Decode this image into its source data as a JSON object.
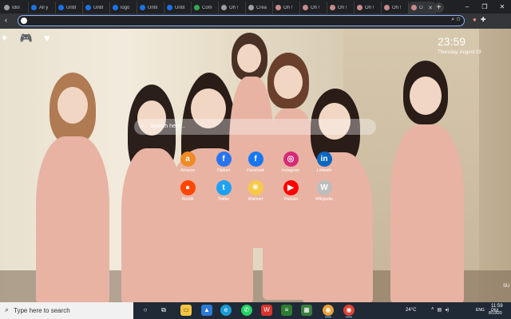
{
  "browser": {
    "tabs": [
      {
        "title": "Idol",
        "color": "#9aa0a6"
      },
      {
        "title": "All y",
        "color": "#1a73e8"
      },
      {
        "title": "Untit",
        "color": "#1a73e8"
      },
      {
        "title": "Untit",
        "color": "#1a73e8"
      },
      {
        "title": "logo",
        "color": "#1a73e8"
      },
      {
        "title": "Untit",
        "color": "#1a73e8"
      },
      {
        "title": "Untit",
        "color": "#1a73e8"
      },
      {
        "title": "Com",
        "color": "#34a853"
      },
      {
        "title": "Oh !",
        "color": "#9aa0a6"
      },
      {
        "title": "Crea",
        "color": "#9aa0a6"
      },
      {
        "title": "Oh !",
        "color": "#c98b8b"
      },
      {
        "title": "Oh !",
        "color": "#c98b8b"
      },
      {
        "title": "Oh !",
        "color": "#c98b8b"
      },
      {
        "title": "Oh !",
        "color": "#c98b8b"
      },
      {
        "title": "Oh !",
        "color": "#c98b8b"
      },
      {
        "title": "O",
        "color": "#c98b8b",
        "active": true
      }
    ],
    "omnibox_value": ""
  },
  "newtab": {
    "clock": "23:59",
    "date": "Thursday, August 19",
    "search_placeholder": "Search here...",
    "shortcuts": [
      {
        "label": "Amazon",
        "icon": "amazon-icon",
        "glyph": "a",
        "color": "#f08a24"
      },
      {
        "label": "Flipkart",
        "icon": "flipkart-icon",
        "glyph": "f",
        "color": "#2874f0"
      },
      {
        "label": "Facebook",
        "icon": "facebook-icon",
        "glyph": "f",
        "color": "#1877f2"
      },
      {
        "label": "Instagram",
        "icon": "instagram-icon",
        "glyph": "◎",
        "color": "#d62976"
      },
      {
        "label": "Linkedin",
        "icon": "linkedin-icon",
        "glyph": "in",
        "color": "#0a66c2"
      },
      {
        "label": "Reddit",
        "icon": "reddit-icon",
        "glyph": "●",
        "color": "#ff4500"
      },
      {
        "label": "Twitter",
        "icon": "twitter-icon",
        "glyph": "t",
        "color": "#1da1f2"
      },
      {
        "label": "Walmart",
        "icon": "walmart-icon",
        "glyph": "✳",
        "color": "#f7c948"
      },
      {
        "label": "Youtube",
        "icon": "youtube-icon",
        "glyph": "▶",
        "color": "#ff0000"
      },
      {
        "label": "Wikipedia",
        "icon": "wikipedia-icon",
        "glyph": "W",
        "color": "#bdbdbd"
      }
    ],
    "corner_text": "SU"
  },
  "taskbar": {
    "search_text": "Type here to search",
    "weather": "24°C",
    "language": "ENG",
    "time": "11:59 PM",
    "date": "8/19/20"
  }
}
